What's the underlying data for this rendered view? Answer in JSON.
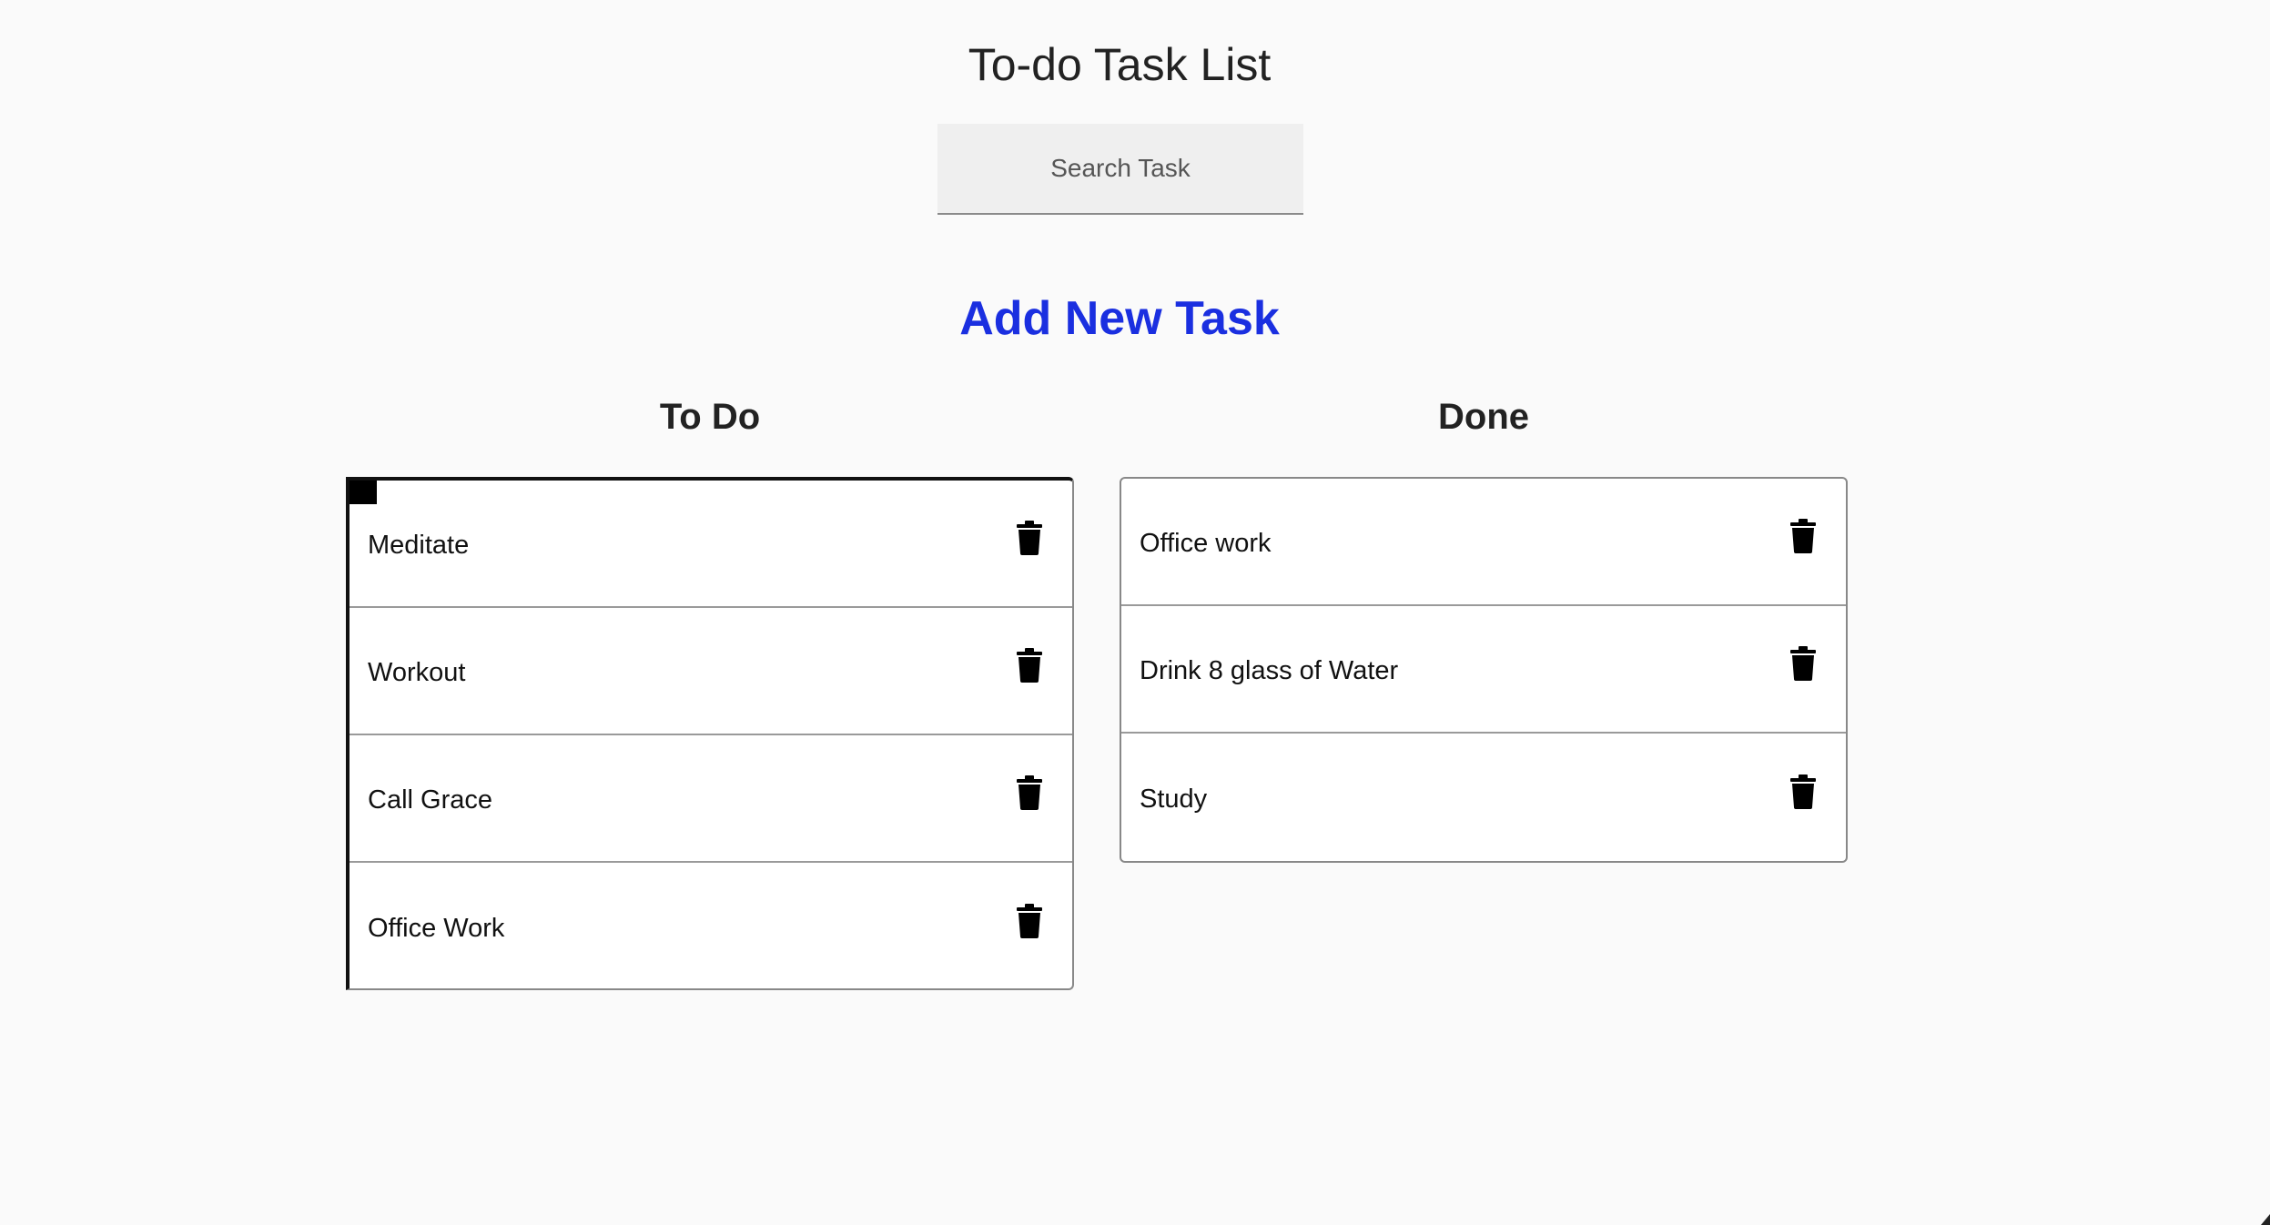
{
  "app": {
    "title": "To-do Task List"
  },
  "search": {
    "placeholder": "Search Task",
    "value": ""
  },
  "add_task": {
    "label": "Add New Task",
    "color": "#1a2fe0"
  },
  "columns": {
    "todo": {
      "title": "To Do",
      "items": [
        {
          "label": "Meditate",
          "icon": "trash-icon"
        },
        {
          "label": "Workout",
          "icon": "trash-icon"
        },
        {
          "label": "Call Grace",
          "icon": "trash-icon"
        },
        {
          "label": "Office Work",
          "icon": "trash-icon"
        }
      ]
    },
    "done": {
      "title": "Done",
      "items": [
        {
          "label": "Office work",
          "icon": "trash-icon"
        },
        {
          "label": "Drink 8 glass of Water",
          "icon": "trash-icon"
        },
        {
          "label": "Study",
          "icon": "trash-icon"
        }
      ]
    }
  }
}
